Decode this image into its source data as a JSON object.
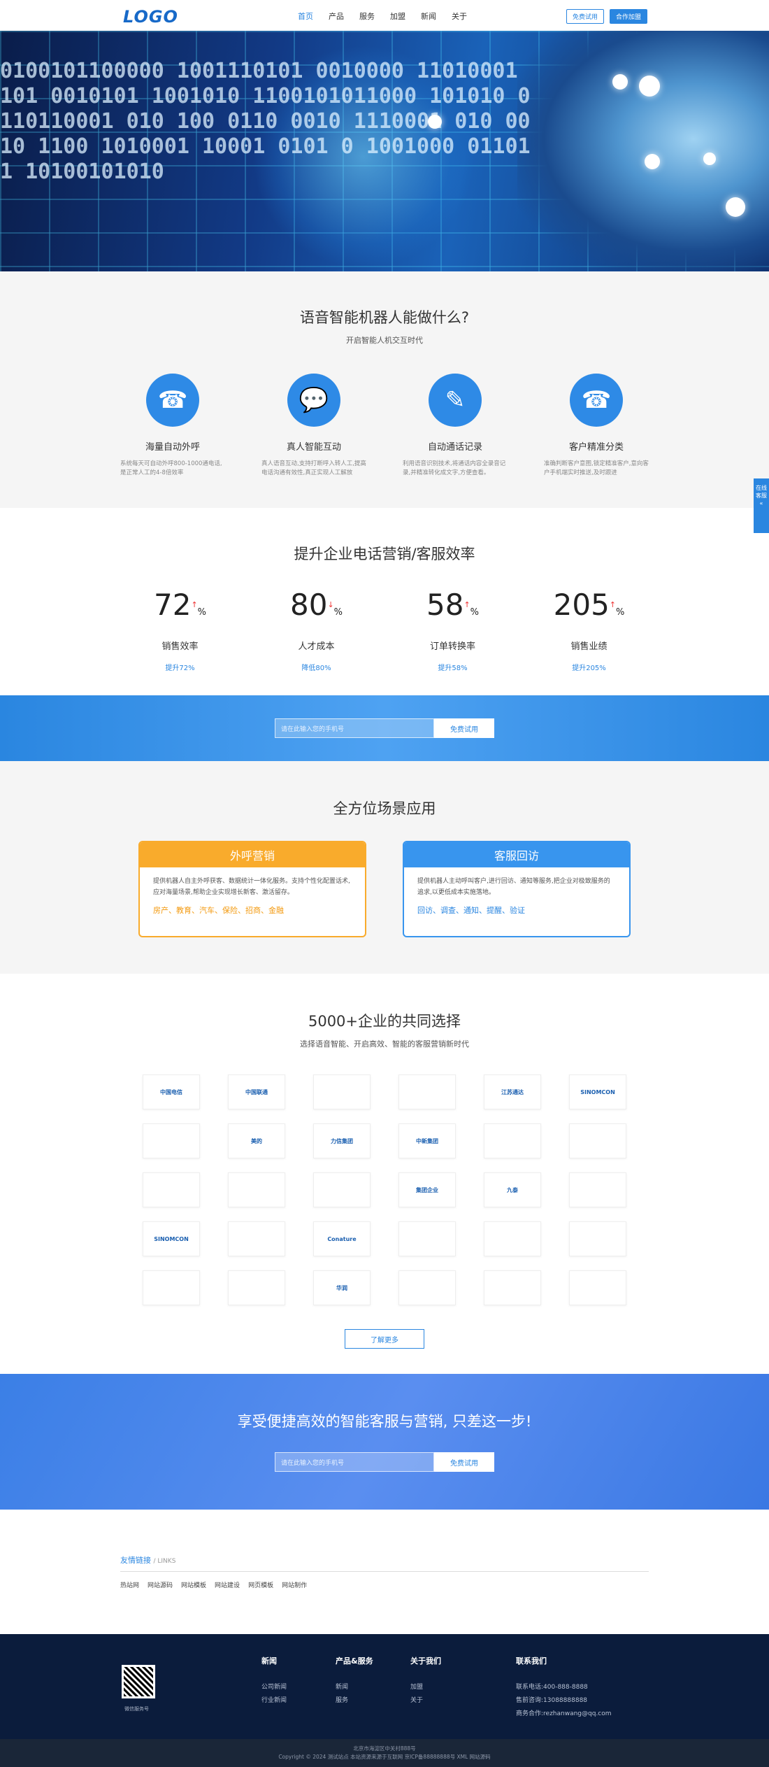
{
  "header": {
    "logo": "LOGO",
    "nav": [
      "首页",
      "产品",
      "服务",
      "加盟",
      "新闻",
      "关于"
    ],
    "trial_btn": "免费试用",
    "join_btn": "合作加盟"
  },
  "banner": {
    "digits": "0100101100000 1001110101 0010000 11010001 101 0010101 1001010 1100101011000 101010 0110110001 010 100 0110 0010 1110001 010 0010 1100 1010001 10001 0101 0 1001000 011011 10100101010"
  },
  "ability": {
    "title": "语音智能机器人能做什么?",
    "subtitle": "开启智能人机交互时代",
    "items": [
      {
        "title": "海量自动外呼",
        "desc": "系统每天可自动外呼800-1000通电话,是正常人工的4-8倍效率"
      },
      {
        "title": "真人智能互动",
        "desc": "真人语音互动,支持打断呼入转人工,提高电话沟通有效性,真正实现人工解放"
      },
      {
        "title": "自动通话记录",
        "desc": "利用语音识别技术,将通话内容全录音记录,并精准转化成文字,方便查看。"
      },
      {
        "title": "客户精准分类",
        "desc": "准确判断客户意图,锁定精准客户,意向客户手机端实时推送,及时跟进"
      }
    ]
  },
  "stats": {
    "title": "提升企业电话营销/客服效率",
    "items": [
      {
        "num": "72",
        "label": "销售效率",
        "inc": "提升72%"
      },
      {
        "num": "80",
        "label": "人才成本",
        "inc": "降低80%"
      },
      {
        "num": "58",
        "label": "订单转换率",
        "inc": "提升58%"
      },
      {
        "num": "205",
        "label": "销售业绩",
        "inc": "提升205%"
      }
    ]
  },
  "trial": {
    "placeholder": "请在此输入您的手机号",
    "button": "免费试用"
  },
  "scenes": {
    "title": "全方位场景应用",
    "cards": [
      {
        "head": "外呼营销",
        "body": "提供机器人自主外呼获客、数据统计一体化服务。支持个性化配置话术,应对海量场景,帮助企业实现增长新客、激活留存。",
        "tags": "房产、教育、汽车、保险、招商、金融"
      },
      {
        "head": "客服回访",
        "body": "提供机器人主动呼叫客户,进行回访、通知等服务,把企业对极致服务的追求,以更低成本实施落地。",
        "tags": "回访、调查、通知、提醒、验证"
      }
    ]
  },
  "partners": {
    "title": "5000+企业的共同选择",
    "subtitle": "选择语音智能、开启高效、智能的客服营销新时代",
    "logos": [
      "中国电信",
      "中国联通",
      "",
      "",
      "江苏通达",
      "SINOMCON",
      "",
      "美的",
      "力信集团",
      "中新集团",
      "",
      "",
      "",
      "",
      "",
      "集团企业",
      "九泰",
      "",
      "SINOMCON",
      "",
      "Conature",
      "",
      "",
      "",
      "",
      "",
      "华润",
      "",
      "",
      ""
    ],
    "more": "了解更多"
  },
  "cta": {
    "title": "享受便捷高效的智能客服与营销, 只差这一步!",
    "placeholder": "请在此输入您的手机号",
    "button": "免费试用"
  },
  "links": {
    "head": "友情链接",
    "head_en": "/ LINKS",
    "items": [
      "热站网",
      "网站源码",
      "网站模板",
      "网站建设",
      "网页模板",
      "网站制作"
    ]
  },
  "footer": {
    "qr_label": "微信服务号",
    "cols": [
      {
        "head": "新闻",
        "items": [
          "公司新闻",
          "行业新闻"
        ]
      },
      {
        "head": "产品&服务",
        "items": [
          "新闻",
          "服务"
        ]
      },
      {
        "head": "关于我们",
        "items": [
          "加盟",
          "关于"
        ]
      },
      {
        "head": "联系我们",
        "items": [
          "联系电话:400-888-8888",
          "售前咨询:13088888888",
          "商务合作:rezhanwang@qq.com"
        ]
      }
    ],
    "address": "北京市海淀区中关村888号",
    "copyright": "Copyright © 2024 测试站点 本站资源来源于互联网 京ICP备88888888号 XML 网站源码"
  },
  "side": {
    "label": "在线客服"
  },
  "colors": {
    "accent": "#2a86e0",
    "orange": "#f9ab2c",
    "footer": "#0b1c3c"
  }
}
